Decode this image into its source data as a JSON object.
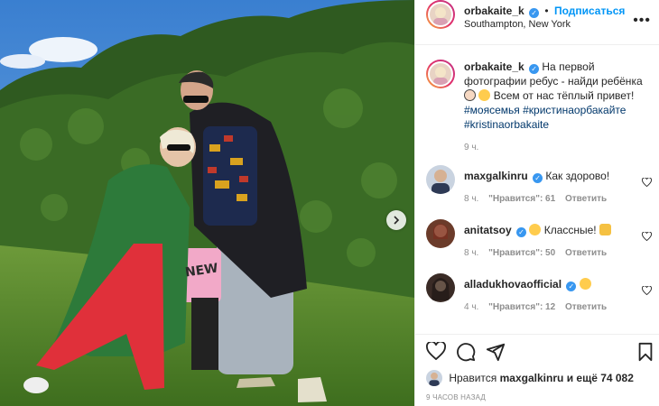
{
  "post": {
    "author": "orbakaite_k",
    "follow_label": "Подписаться",
    "location": "Southampton, New York",
    "more_label": "•••"
  },
  "caption": {
    "author": "orbakaite_k",
    "text": "На первой фотографии ребус - найди ребёнка",
    "text2": "Всем от нас тёплый привет!",
    "tag1": "#моясемья",
    "tag2": "#кристинаорбакайте",
    "tag3": "#kristinaorbakaite",
    "time": "9 ч."
  },
  "comments": [
    {
      "user": "maxgalkinru",
      "text": "Как здорово!",
      "time": "8 ч.",
      "likes": "\"Нравится\": 61",
      "reply": "Ответить"
    },
    {
      "user": "anitatsoy",
      "text": "Классные!",
      "time": "8 ч.",
      "likes": "\"Нравится\": 50",
      "reply": "Ответить"
    },
    {
      "user": "alladukhovaofficial",
      "text": "",
      "time": "4 ч.",
      "likes": "\"Нравится\": 12",
      "reply": "Ответить"
    }
  ],
  "likes": {
    "prefix": "Нравится",
    "user": "maxgalkinru",
    "suffix": "и ещё 74 082"
  },
  "posted_ago": "9 ЧАСОВ НАЗАД",
  "photo": {
    "shirt_text": "NEW"
  },
  "icons": [
    "heart-icon",
    "comment-icon",
    "share-icon",
    "bookmark-icon",
    "verified-icon",
    "next-arrow-icon",
    "more-icon"
  ],
  "colors": {
    "link": "#0095f6",
    "hashtag": "#00376b",
    "verified": "#3897f0",
    "muted": "#8e8e8e"
  }
}
